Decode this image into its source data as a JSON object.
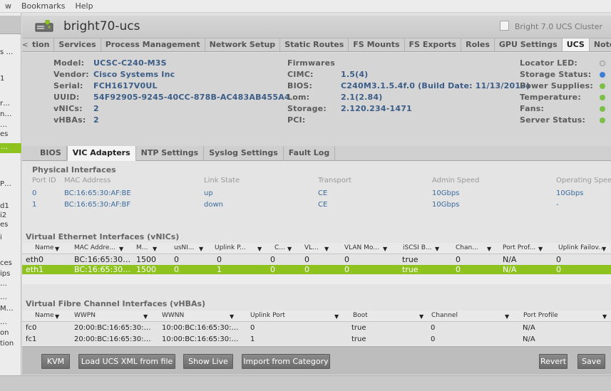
{
  "menubar": {
    "items": [
      "w",
      "Bookmarks",
      "Help"
    ]
  },
  "left_strip": [
    "s …",
    "1",
    "r…",
    "n…",
    "…",
    "es",
    "…",
    "P…",
    "d1",
    "i2",
    "es",
    "i",
    "ces",
    "ips",
    "…",
    "…",
    "M…",
    "…",
    "on",
    "tion"
  ],
  "header": {
    "title": "bright70-ucs",
    "cluster": "Bright 7.0 UCS Cluster"
  },
  "tabs": {
    "scroll_left": "<",
    "scroll_right": ">",
    "items": [
      "tion",
      "Services",
      "Process Management",
      "Network Setup",
      "Static Routes",
      "FS Mounts",
      "FS Exports",
      "Roles",
      "GPU Settings",
      "UCS",
      "Notes"
    ],
    "active": "UCS"
  },
  "info": {
    "left": [
      {
        "label": "Model:",
        "value": "UCSC-C240-M3S"
      },
      {
        "label": "Vendor:",
        "value": "Cisco Systems Inc"
      },
      {
        "label": "Serial:",
        "value": "FCH1617V0UL"
      },
      {
        "label": "UUID:",
        "value": "54F92905-9245-40CC-878B-AC483AB455A4"
      },
      {
        "label": "vNICs:",
        "value": "2"
      },
      {
        "label": "vHBAs:",
        "value": "2"
      }
    ],
    "middle": [
      {
        "label": "Firmwares",
        "value": ""
      },
      {
        "label": "CIMC:",
        "value": "1.5(4)"
      },
      {
        "label": "BIOS:",
        "value": "C240M3.1.5.4f.0 (Build Date: 11/13/2013)"
      },
      {
        "label": "Lom:",
        "value": "2.1(2.84)"
      },
      {
        "label": "Storage:",
        "value": "2.120.234-1471"
      },
      {
        "label": "PCI:",
        "value": ""
      }
    ],
    "right": [
      {
        "label": "Locator LED:",
        "status": "off",
        "color": "#cfcfcf"
      },
      {
        "label": "Storage Status:",
        "status": "blue",
        "color": "#3a7fd5"
      },
      {
        "label": "Power Supplies:",
        "status": "ok",
        "color": "#7bc043"
      },
      {
        "label": "Temperature:",
        "status": "ok",
        "color": "#7bc043"
      },
      {
        "label": "Fans:",
        "status": "ok",
        "color": "#7bc043"
      },
      {
        "label": "Server Status:",
        "status": "ok",
        "color": "#7bc043"
      }
    ]
  },
  "subtabs": {
    "items": [
      "BIOS",
      "VIC Adapters",
      "NTP Settings",
      "Syslog Settings",
      "Fault Log"
    ],
    "active": "VIC Adapters"
  },
  "physical": {
    "title": "Physical Interfaces",
    "headers": [
      "Port ID",
      "MAC Address",
      "Link State",
      "Transport",
      "Admin Speed",
      "Operating Spee"
    ],
    "rows": [
      [
        "0",
        "BC:16:65:30:AF:BE",
        "up",
        "CE",
        "10Gbps",
        "10Gbps"
      ],
      [
        "1",
        "BC:16:65:30:AF:BF",
        "down",
        "CE",
        "10Gbps",
        "-"
      ]
    ]
  },
  "vnics": {
    "title": "Virtual Ethernet Interfaces (vNICs)",
    "headers": [
      "Name",
      "MAC Addre...",
      "M...",
      "usNI...",
      "Uplink P...",
      "C...",
      "VL...",
      "VLAN Mo...",
      "iSCSI B...",
      "Chan...",
      "Port Prof...",
      "Uplink Failov..."
    ],
    "rows": [
      [
        "eth0",
        "BC:16:65:30…",
        "1500",
        "0",
        "0",
        "0",
        "0",
        "0",
        "true",
        "0",
        "N/A",
        "0"
      ],
      [
        "eth1",
        "BC:16:65:30…",
        "1500",
        "0",
        "1",
        "0",
        "0",
        "0",
        "true",
        "0",
        "N/A",
        "0"
      ]
    ],
    "selected_row": 1
  },
  "vhbas": {
    "title": "Virtual Fibre Channel Interfaces (vHBAs)",
    "headers": [
      "Name",
      "WWPN",
      "WWNN",
      "Uplink Port",
      "Boot",
      "Channel",
      "Port Profile"
    ],
    "rows": [
      [
        "fc0",
        "20:00:BC:16:65:30:…",
        "10:00:BC:16:65:30:…",
        "0",
        "true",
        "0",
        "N/A"
      ],
      [
        "fc1",
        "20:00:BC:16:65:30:…",
        "10:00:BC:16:65:30:…",
        "1",
        "true",
        "0",
        "N/A"
      ]
    ]
  },
  "buttons": {
    "kvm": "KVM",
    "load_xml": "Load UCS XML from file",
    "show_live": "Show Live",
    "import_category": "Import from Category",
    "revert": "Revert",
    "save": "Save"
  },
  "icons": {
    "server": "server-icon",
    "cluster": "cluster-icon",
    "dropdown": "chevron-down-icon"
  },
  "colors": {
    "selection": "#8dc21f",
    "value_text": "#3c5d87",
    "status_ok": "#7bc043",
    "status_blue": "#3a7fd5"
  }
}
